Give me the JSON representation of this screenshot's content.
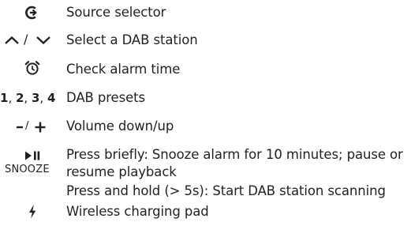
{
  "rows": [
    {
      "icon": "source-selector-icon",
      "description": "Source selector"
    },
    {
      "icon": "up-down-chevron-icon",
      "description": "Select a DAB station"
    },
    {
      "icon": "alarm-clock-icon",
      "description": "Check alarm time"
    },
    {
      "icon": "preset-numbers",
      "presets": [
        "1",
        "2",
        "3",
        "4"
      ],
      "description": "DAB presets"
    },
    {
      "icon": "volume-minus-plus-icon",
      "description": "Volume down/up"
    },
    {
      "icon": "play-pause-icon",
      "icon_label": "SNOOZE",
      "lines": [
        "Press briefly: Snooze alarm for 10 minutes; pause or",
        "resume playback",
        "Press and hold (> 5s): Start DAB station scanning"
      ]
    },
    {
      "icon": "lightning-bolt-icon",
      "description": "Wireless charging pad"
    }
  ]
}
